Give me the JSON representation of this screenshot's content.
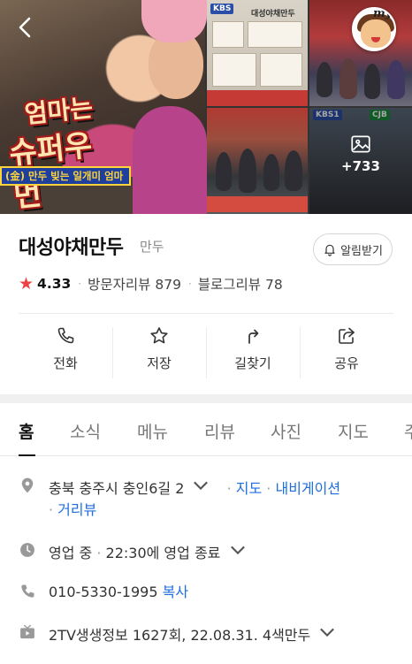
{
  "photos": {
    "main_title_line1": "엄마는",
    "main_title_line2": "슈퍼우먼",
    "main_caption": "(金) 만두 빚는 일개미 엄마",
    "thumb_a_tag": "KBS",
    "thumb_a_banner": "대성야채만두",
    "thumb_d_tag1": "KBS1",
    "thumb_d_tag2": "CJB",
    "more_count": "+733"
  },
  "place": {
    "name": "대성야채만두",
    "category": "만두",
    "notify_label": "알림받기"
  },
  "rating": {
    "score": "4.33",
    "visitor_reviews": "방문자리뷰 879",
    "blog_reviews": "블로그리뷰 78"
  },
  "actions": [
    {
      "label": "전화",
      "icon": "phone-icon"
    },
    {
      "label": "저장",
      "icon": "star-outline-icon"
    },
    {
      "label": "길찾기",
      "icon": "directions-icon"
    },
    {
      "label": "공유",
      "icon": "share-icon"
    }
  ],
  "tabs": [
    {
      "label": "홈",
      "active": true
    },
    {
      "label": "소식"
    },
    {
      "label": "메뉴"
    },
    {
      "label": "리뷰"
    },
    {
      "label": "사진"
    },
    {
      "label": "지도"
    },
    {
      "label": "주"
    }
  ],
  "info": {
    "address": "충북 충주시 충인6길 2",
    "map_link": "지도",
    "nav_link": "내비게이션",
    "street_view_link": "거리뷰",
    "hours_status": "영업 중",
    "hours_detail": "22:30에 영업 종료",
    "phone": "010-5330-1995",
    "copy_label": "복사",
    "tv_info": "2TV생생정보 1627회, 22.08.31. 4색만두"
  },
  "colors": {
    "star": "#f04242",
    "link": "#1f6ee0",
    "divider_band": "#f0f0f0"
  }
}
